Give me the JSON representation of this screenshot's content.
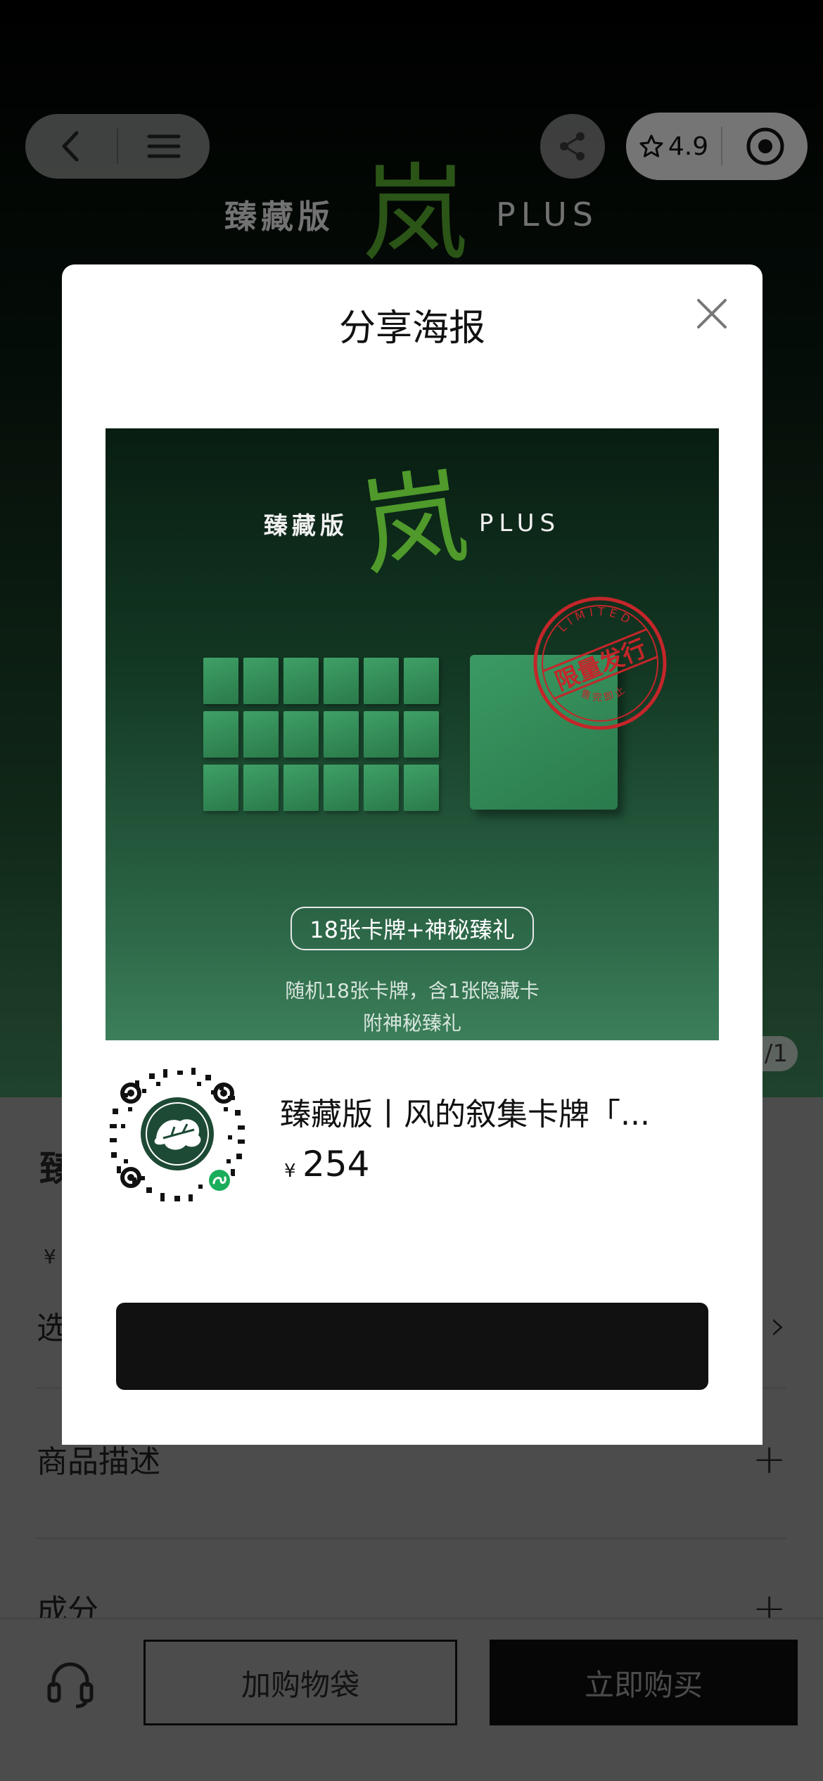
{
  "background_page": {
    "hero_brand": {
      "edition": "臻藏版",
      "logo_char": "岚",
      "plus": "PLUS"
    },
    "rating": "4.9",
    "page_indicator": "1/1",
    "title_partial": "臻",
    "price_symbol": "¥",
    "rows": [
      {
        "label": "选",
        "sign": "›"
      },
      {
        "label": "商品描述",
        "sign": "+"
      },
      {
        "label": "成分",
        "sign": "+"
      }
    ],
    "bottom_bar": {
      "add_to_bag": "加购物袋",
      "buy_now": "立即购买"
    }
  },
  "modal": {
    "title": "分享海报",
    "poster": {
      "edition": "臻藏版",
      "logo_char": "岚",
      "plus": "PLUS",
      "stamp_text_top": "LIMITED",
      "stamp_text_main": "限量发行",
      "stamp_text_bottom": "售完即止",
      "pill": "18张卡牌+神秘臻礼",
      "desc_line1": "随机18张卡牌，含1张隐藏卡",
      "desc_line2": "附神秘臻礼"
    },
    "product_name": "臻藏版丨风的叙集卡牌「...",
    "price_symbol": "¥",
    "price": "254",
    "save_button": ""
  },
  "colors": {
    "accent_green": "#4f9a2b",
    "stamp_red": "#c4262a",
    "button_black": "#111111"
  }
}
